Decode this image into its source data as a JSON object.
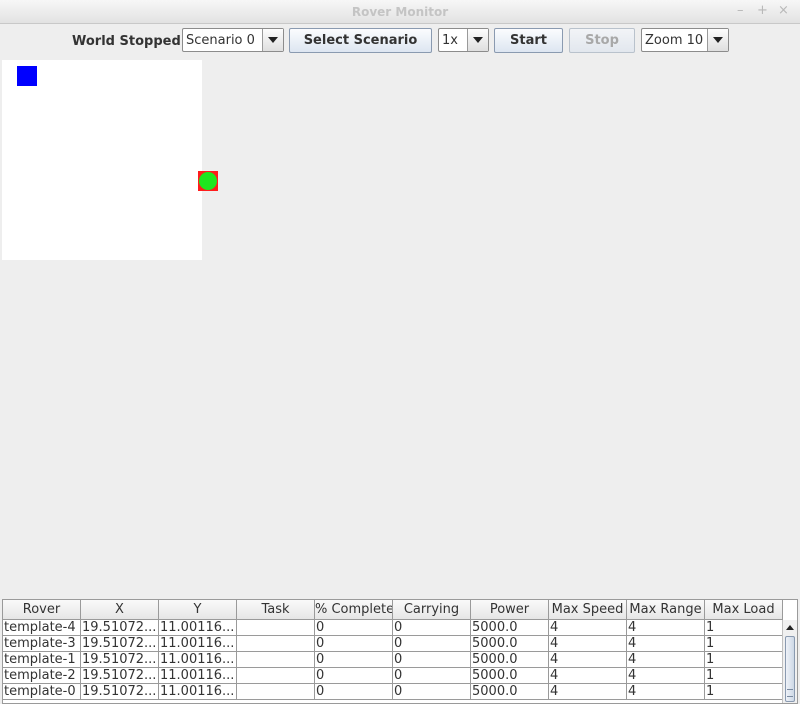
{
  "window": {
    "title": "Rover Monitor",
    "minimize": "–",
    "maximize": "+",
    "close": "×"
  },
  "toolbar": {
    "status": "World Stopped",
    "scenario_value": "Scenario 0",
    "select_scenario_label": "Select Scenario",
    "speed_value": "1x",
    "start_label": "Start",
    "stop_label": "Stop",
    "zoom_value": "Zoom 10"
  },
  "world": {
    "rover_color": "#0000ff",
    "target_color": "#1ee61e",
    "target_border_color": "#ff1c1c"
  },
  "table": {
    "columns": [
      "Rover",
      "X",
      "Y",
      "Task",
      "% Complete",
      "Carrying",
      "Power",
      "Max Speed",
      "Max Range",
      "Max Load"
    ],
    "rows": [
      [
        "template-4",
        "19.51072...",
        "11.00116...",
        "",
        "0",
        "0",
        "5000.0",
        "4",
        "4",
        "1"
      ],
      [
        "template-3",
        "19.51072...",
        "11.00116...",
        "",
        "0",
        "0",
        "5000.0",
        "4",
        "4",
        "1"
      ],
      [
        "template-1",
        "19.51072...",
        "11.00116...",
        "",
        "0",
        "0",
        "5000.0",
        "4",
        "4",
        "1"
      ],
      [
        "template-2",
        "19.51072...",
        "11.00116...",
        "",
        "0",
        "0",
        "5000.0",
        "4",
        "4",
        "1"
      ],
      [
        "template-0",
        "19.51072...",
        "11.00116...",
        "",
        "0",
        "0",
        "5000.0",
        "4",
        "4",
        "1"
      ]
    ]
  }
}
